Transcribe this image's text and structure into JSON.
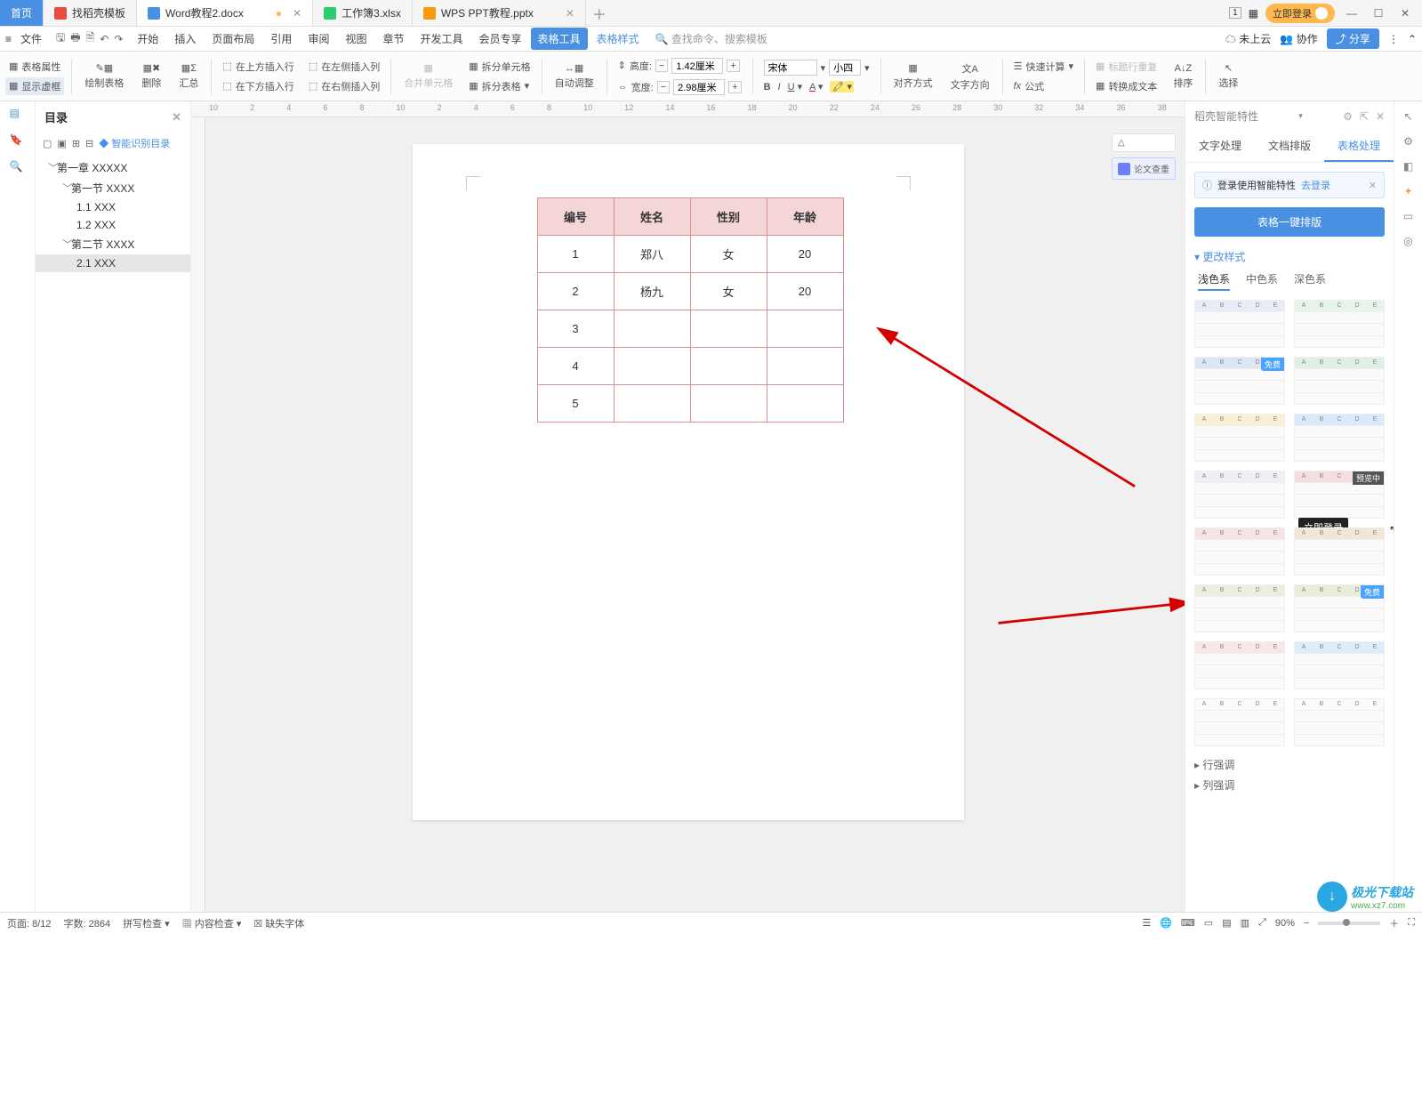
{
  "tabs": {
    "home": "首页",
    "t1": "找稻壳模板",
    "t2": "Word教程2.docx",
    "t3": "工作簿3.xlsx",
    "t4": "WPS PPT教程.pptx",
    "loginBtn": "立即登录",
    "badge1": "1"
  },
  "menu": {
    "file": "文件",
    "items": [
      "开始",
      "插入",
      "页面布局",
      "引用",
      "审阅",
      "视图",
      "章节",
      "开发工具",
      "会员专享",
      "表格工具",
      "表格样式"
    ],
    "searchPlaceholder": "查找命令、搜索模板",
    "cloud": "未上云",
    "collab": "协作",
    "share": "分享"
  },
  "ribbon": {
    "tableProps": "表格属性",
    "showGrid": "显示虚框",
    "drawTable": "绘制表格",
    "delete": "删除",
    "summary": "汇总",
    "insertRowAbove": "在上方插入行",
    "insertRowBelow": "在下方插入行",
    "insertColLeft": "在左侧插入列",
    "insertColRight": "在右侧插入列",
    "mergeCells": "合并单元格",
    "splitCells": "拆分单元格",
    "splitTable": "拆分表格",
    "autoFit": "自动调整",
    "height": "高度:",
    "heightVal": "1.42厘米",
    "width": "宽度:",
    "widthVal": "2.98厘米",
    "font": "字体",
    "fontVal": "宋体",
    "sizeVal": "小四",
    "align": "对齐方式",
    "textDir": "文字方向",
    "quickCalc": "快速计算",
    "formula": "公式",
    "titleRepeat": "标题行重复",
    "toText": "转换成文本",
    "sort": "排序",
    "select": "选择"
  },
  "outline": {
    "title": "目录",
    "smart": "智能识别目录",
    "tree": {
      "c1": "第一章 XXXXX",
      "s1": "第一节 XXXX",
      "i11": "1.1 XXX",
      "i12": "1.2 XXX",
      "s2": "第二节 XXXX",
      "i21": "2.1 XXX"
    }
  },
  "docTable": {
    "headers": [
      "编号",
      "姓名",
      "性别",
      "年龄"
    ],
    "rows": [
      [
        "1",
        "郑八",
        "女",
        "20"
      ],
      [
        "2",
        "杨九",
        "女",
        "20"
      ],
      [
        "3",
        "",
        "",
        ""
      ],
      [
        "4",
        "",
        "",
        ""
      ],
      [
        "5",
        "",
        "",
        ""
      ]
    ]
  },
  "floatBtn": "论文查重",
  "rightPanel": {
    "title": "稻壳智能特性",
    "tabs": [
      "文字处理",
      "文档排版",
      "表格处理"
    ],
    "bannerText": "登录使用智能特性",
    "bannerLink": "去登录",
    "mainBtn": "表格一键排版",
    "changeStyle": "更改样式",
    "colorTabs": [
      "浅色系",
      "中色系",
      "深色系"
    ],
    "free": "免费",
    "preview": "预览中",
    "loginNow": "立即登录",
    "rowAdjust": "行强调",
    "colAdjust": "列强调"
  },
  "status": {
    "page": "页面: 8/12",
    "words": "字数: 2864",
    "spell": "拼写检查",
    "content": "内容检查",
    "missing": "缺失字体",
    "zoom": "90%"
  },
  "rulerMarks": [
    "10",
    "2",
    "4",
    "6",
    "8",
    "10",
    "2",
    "4",
    "6",
    "8",
    "10",
    "12",
    "14",
    "16",
    "18",
    "20",
    "22",
    "24",
    "26",
    "28",
    "30",
    "32",
    "34",
    "36",
    "38"
  ],
  "watermark": {
    "name": "极光下载站",
    "url": "www.xz7.com"
  }
}
